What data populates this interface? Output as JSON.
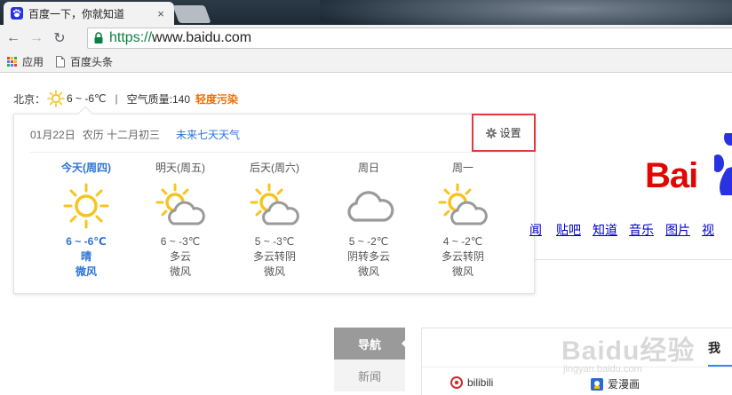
{
  "browser": {
    "tab": {
      "title": "百度一下，你就知道",
      "close": "×"
    },
    "url": {
      "scheme": "https://",
      "host": "www.baidu.com"
    },
    "nav": {
      "back": "←",
      "forward": "→",
      "reload": "↻"
    },
    "bookmarks": [
      {
        "label": "应用",
        "icon": "apps-icon"
      },
      {
        "label": "百度头条",
        "icon": "page-icon"
      }
    ]
  },
  "weather": {
    "city": "北京：",
    "today_range": "6 ~ -6℃",
    "separator": "|",
    "air_quality_label": "空气质量:140",
    "pollution": "轻度污染",
    "popup": {
      "date": "01月22日",
      "lunar": "农历 十二月初三",
      "week_link": "未来七天天气",
      "settings": "设置",
      "days": [
        {
          "name": "今天(周四)",
          "icon": "sun",
          "temp": "6 ~ -6℃",
          "condition": "晴",
          "wind": "微风",
          "today": true
        },
        {
          "name": "明天(周五)",
          "icon": "sun-cloud",
          "temp": "6 ~ -3℃",
          "condition": "多云",
          "wind": "微风",
          "today": false
        },
        {
          "name": "后天(周六)",
          "icon": "sun-cloud",
          "temp": "5 ~ -3℃",
          "condition": "多云转阴",
          "wind": "微风",
          "today": false
        },
        {
          "name": "周日",
          "icon": "cloud",
          "temp": "5 ~ -2℃",
          "condition": "阴转多云",
          "wind": "微风",
          "today": false
        },
        {
          "name": "周一",
          "icon": "sun-cloud",
          "temp": "4 ~ -2℃",
          "condition": "多云转阴",
          "wind": "微风",
          "today": false
        }
      ]
    }
  },
  "baidu": {
    "logo_text": "Bai",
    "nav_links": [
      {
        "label": "闻",
        "partial": true
      },
      {
        "label": "贴吧",
        "partial": false
      },
      {
        "label": "知道",
        "partial": false
      },
      {
        "label": "音乐",
        "partial": false
      },
      {
        "label": "图片",
        "partial": false
      },
      {
        "label": "视",
        "partial": false
      }
    ],
    "side_tabs": {
      "active": "导航",
      "inactive": "新闻"
    },
    "my_tab": "我",
    "sites": [
      {
        "label": "bilibili",
        "icon": "bilibili-icon"
      },
      {
        "label": "爱漫画",
        "icon": "manhua-icon"
      }
    ]
  },
  "watermark": {
    "text": "Baidu经验",
    "url": "jingyan.baidu.com"
  },
  "colors": {
    "link_blue": "#2b74d6",
    "pollution_orange": "#f26d00",
    "baidu_red": "#e10602",
    "highlight_red": "#e8383d",
    "sun_yellow": "#f7c41f"
  }
}
